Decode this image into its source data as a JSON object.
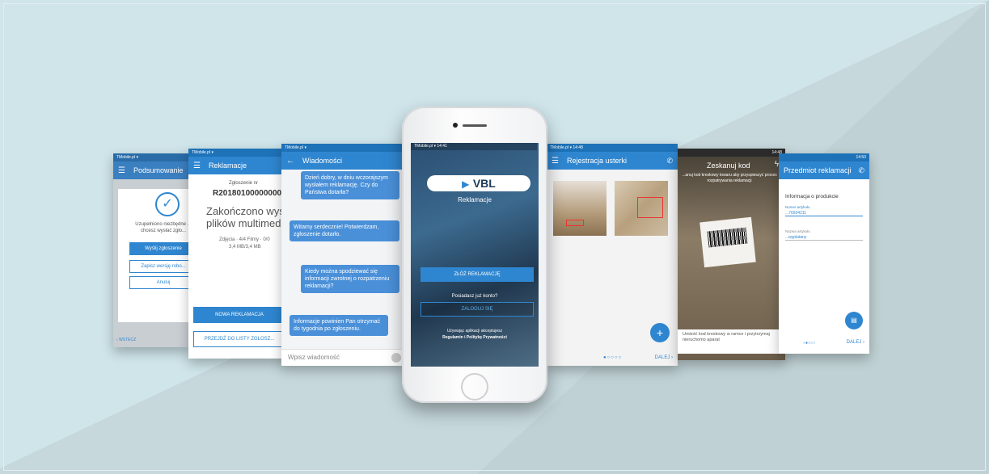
{
  "podsumowanie": {
    "status": "TMobile.pl  ▾",
    "title": "Podsumowanie",
    "message": "Uzupełniono niezbędne ... chcesz wysłać zgło...",
    "send_btn": "Wyślij zgłoszenie",
    "save_btn": "Zapisz wersję robo...",
    "cancel_btn": "Anuluj",
    "back": "WSTECZ"
  },
  "reklamacje": {
    "status": "TMobile.pl  ▾",
    "title": "Reklamacje",
    "label": "Zgłoszenie nr",
    "number": "R201801000000001",
    "heading": "Zakończono wysy... plików multimedia...",
    "line1": "Zdjęcia · 4/4    Filmy · 0/0",
    "line2": "3,4 MB/3,4 MB",
    "new_btn": "NOWA REKLAMACJA",
    "list_btn": "PRZEJDŹ DO LISTY ZGŁOSZ..."
  },
  "wiadomosci": {
    "status": "TMobile.pl  ▾",
    "title": "Wiadomości",
    "messages": [
      "Dzień dobry, w dniu wczorajszym wysłałem reklamację. Czy do Państwa dotarła?",
      "Witamy serdecznie! Potwierdzam, zgłoszenie dotarło.",
      "Kiedy można spodziewać się informacji zwrotnej o rozpatrzeniu reklamacji?",
      "Informacje powinien Pan otrzymać do tygodnia po zgłoszeniu."
    ],
    "input_placeholder": "Wpisz wiadomość"
  },
  "login": {
    "status": "TMobile.pl  ▾  14:41",
    "logo": "VBL",
    "subtitle": "Reklamacje",
    "submit_btn": "ZŁÓŻ REKLAMACJĘ",
    "have_account": "Posiadasz już konto?",
    "login_btn": "ZALOGUJ SIĘ",
    "terms1": "Używając aplikacji akceptujesz",
    "terms2": "Regulamin i Politykę Prywatności"
  },
  "rejestracja": {
    "status": "TMobile.pl  ▾  14:48",
    "title": "Rejestracja usterki",
    "next": "DALEJ"
  },
  "skan": {
    "status": "14:48",
    "title": "Zeskanuj kod",
    "text": "...anuj kod kreskowy towaru aby przyspieszyć proces rozpatrywania reklamacji",
    "hint": "Umieść kod kreskowy w ramce i przytrzymaj nieruchomo aparat"
  },
  "przedmiot": {
    "status": "14:50",
    "title": "Przedmiot reklamacji",
    "section": "Informacja o produkcie",
    "field1_label": "Numer artykułu",
    "field1_value": "...76934211",
    "field2_label": "Nazwa artykułu",
    "field2_value": "...wyplatany",
    "next": "DALEJ"
  },
  "colors": {
    "primary": "#2f86d0",
    "dark": "#1e72b8",
    "bg": "#cfe5ea"
  }
}
